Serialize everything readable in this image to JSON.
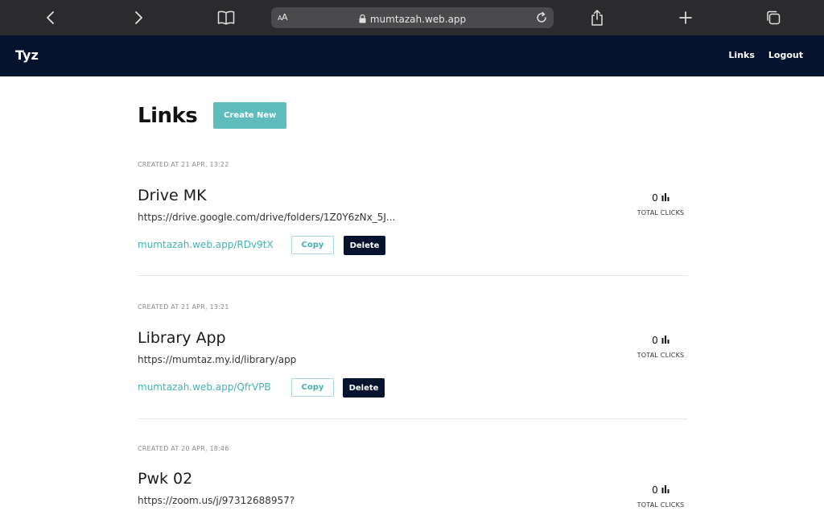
{
  "browser": {
    "url": "mumtazah.web.app",
    "text_size_label": "AA"
  },
  "navbar": {
    "brand": "Tyz",
    "links": [
      "Links",
      "Logout"
    ]
  },
  "page": {
    "title": "Links",
    "create_label": "Create New"
  },
  "cards": [
    {
      "created": "CREATED AT 21 APR, 13:22",
      "title": "Drive MK",
      "url": "https://drive.google.com/drive/folders/1Z0Y6zNx_5J...",
      "short_url": "mumtazah.web.app/RDv9tX",
      "copy_label": "Copy",
      "delete_label": "Delete",
      "clicks": "0",
      "clicks_label": "TOTAL CLICKS"
    },
    {
      "created": "CREATED AT 21 APR, 13:21",
      "title": "Library App",
      "url": "https://mumtaz.my.id/library/app",
      "short_url": "mumtazah.web.app/QfrVPB",
      "copy_label": "Copy",
      "delete_label": "Delete",
      "clicks": "0",
      "clicks_label": "TOTAL CLICKS"
    },
    {
      "created": "CREATED AT 20 APR, 18:46",
      "title": "Pwk 02",
      "url": "https://zoom.us/j/97312688957?",
      "clicks": "0",
      "clicks_label": "TOTAL CLICKS"
    }
  ]
}
